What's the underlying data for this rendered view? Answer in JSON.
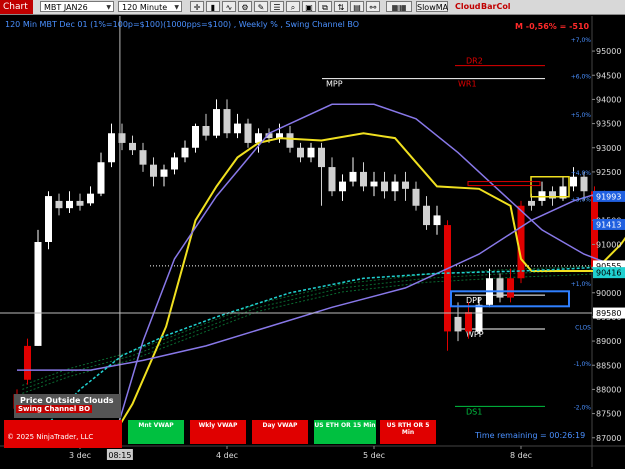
{
  "toolbar": {
    "tab": "Chart",
    "instrument": "MBT JAN26",
    "interval": "120 Minute",
    "btn_slowma": "SlowMA",
    "btn_cloud": "Cloud",
    "btn_barcol": "BarCol"
  },
  "chart": {
    "title": "120 Min MBT Dec 01 (1%=100p=$100)(1000pps=$100) , Weekly % , Swing Channel BO",
    "pnl": "M -0,56% = -510",
    "time_remaining": "Time remaining = 00:26:19",
    "copyright": "© 2025 NinjaTrader, LLC",
    "position_label": "Price Outside Clouds",
    "position_sub": "Swing Channel BO",
    "crosshair_x_label": "08:15",
    "colors": {
      "up": "#ffffff",
      "down": "#d0d0d0",
      "red": "#e00000",
      "yellow": "#f0e020",
      "purple": "#8878e8",
      "cyan": "#20d0d0",
      "axis_blue": "#4a90ff"
    }
  },
  "indicator_boxes": [
    {
      "name": "swing-channel",
      "label": "Swing Channel BO",
      "color": "#e00000"
    },
    {
      "name": "mnt-vwap",
      "label": "Mnt VWAP",
      "color": "#00c040"
    },
    {
      "name": "wkly-vwap",
      "label": "Wkly VWAP",
      "color": "#e00000"
    },
    {
      "name": "day-vwap",
      "label": "Day VWAP",
      "color": "#e00000"
    },
    {
      "name": "us-eth",
      "label": "US ETH OR 15 Min",
      "color": "#00c040"
    },
    {
      "name": "us-rth",
      "label": "US RTH OR 5 Min",
      "color": "#e00000"
    }
  ],
  "price_axis": {
    "ticks": [
      "95000",
      "94500",
      "94000",
      "93500",
      "93000",
      "92500",
      "92000",
      "91500",
      "91000",
      "90500",
      "90000",
      "89500",
      "89000",
      "88500",
      "88000",
      "87500",
      "87000"
    ],
    "pct_labels": [
      {
        "text": "+7,0%",
        "price": 95250
      },
      {
        "text": "+6,0%",
        "price": 94500
      },
      {
        "text": "+5,0%",
        "price": 93700
      },
      {
        "text": "+4,0%",
        "price": 92500
      },
      {
        "text": "+3,0%",
        "price": 91950
      },
      {
        "text": "+1,0%",
        "price": 90200
      },
      {
        "text": "CLOS",
        "price": 89300
      },
      {
        "text": "-1,0%",
        "price": 88550
      },
      {
        "text": "-2,0%",
        "price": 87650
      }
    ],
    "badges": [
      {
        "text": "91993",
        "price": 91993,
        "color": "#2060e0",
        "fg": "#ffffff"
      },
      {
        "text": "91413",
        "price": 91413,
        "color": "#2060e0",
        "fg": "#ffffff"
      },
      {
        "text": "90555",
        "price": 90555,
        "color": "#ffffff",
        "fg": "#000000"
      },
      {
        "text": "90416",
        "price": 90416,
        "color": "#20d0d0",
        "fg": "#000000"
      },
      {
        "text": "89580",
        "price": 89580,
        "color": "#ffffff",
        "fg": "#000000"
      }
    ]
  },
  "time_axis": {
    "labels": [
      {
        "text": "3 dec",
        "bar": 6
      },
      {
        "text": "4 dec",
        "bar": 20
      },
      {
        "text": "5 dec",
        "bar": 34
      },
      {
        "text": "8 dec",
        "bar": 48
      }
    ]
  },
  "levels": [
    {
      "text": "DR2",
      "price": 94700,
      "color": "#e00000"
    },
    {
      "text": "MPP",
      "price": 94430,
      "color": "#ffffff"
    },
    {
      "text": "WR1",
      "price": 94430,
      "color": "#e00000"
    },
    {
      "text": "DPP",
      "price": 89950,
      "color": "#ffffff"
    },
    {
      "text": "WPP",
      "price": 89250,
      "color": "#ffffff"
    },
    {
      "text": "DS1",
      "price": 87650,
      "color": "#00c040"
    }
  ],
  "chart_data": {
    "type": "candlestick",
    "price_range": [
      86800,
      95500
    ],
    "candles": [
      {
        "o": 87600,
        "c": 87900,
        "h": 88000,
        "l": 87500,
        "color": "red"
      },
      {
        "o": 88200,
        "c": 88900,
        "h": 89050,
        "l": 88100,
        "color": "red"
      },
      {
        "o": 88900,
        "c": 91050,
        "h": 91300,
        "l": 88900,
        "color": "up"
      },
      {
        "o": 91050,
        "c": 92000,
        "h": 92100,
        "l": 90900,
        "color": "up"
      },
      {
        "o": 91900,
        "c": 91750,
        "h": 92050,
        "l": 91600,
        "color": "dn"
      },
      {
        "o": 91750,
        "c": 91900,
        "h": 92100,
        "l": 91650,
        "color": "up"
      },
      {
        "o": 91900,
        "c": 91800,
        "h": 92050,
        "l": 91700,
        "color": "dn"
      },
      {
        "o": 91850,
        "c": 92050,
        "h": 92200,
        "l": 91800,
        "color": "up"
      },
      {
        "o": 92050,
        "c": 92700,
        "h": 92900,
        "l": 92000,
        "color": "up"
      },
      {
        "o": 92700,
        "c": 93300,
        "h": 93500,
        "l": 92600,
        "color": "up"
      },
      {
        "o": 93300,
        "c": 93100,
        "h": 93500,
        "l": 92950,
        "color": "dn"
      },
      {
        "o": 93100,
        "c": 92950,
        "h": 93250,
        "l": 92850,
        "color": "dn"
      },
      {
        "o": 92950,
        "c": 92650,
        "h": 93100,
        "l": 92500,
        "color": "dn"
      },
      {
        "o": 92650,
        "c": 92400,
        "h": 92800,
        "l": 92200,
        "color": "dn"
      },
      {
        "o": 92400,
        "c": 92550,
        "h": 92650,
        "l": 92200,
        "color": "up"
      },
      {
        "o": 92550,
        "c": 92800,
        "h": 92900,
        "l": 92450,
        "color": "up"
      },
      {
        "o": 92800,
        "c": 93000,
        "h": 93150,
        "l": 92700,
        "color": "up"
      },
      {
        "o": 93000,
        "c": 93450,
        "h": 93500,
        "l": 92900,
        "color": "up"
      },
      {
        "o": 93450,
        "c": 93250,
        "h": 93700,
        "l": 93150,
        "color": "dn"
      },
      {
        "o": 93250,
        "c": 93800,
        "h": 94000,
        "l": 93200,
        "color": "up"
      },
      {
        "o": 93800,
        "c": 93300,
        "h": 94000,
        "l": 93200,
        "color": "dn"
      },
      {
        "o": 93300,
        "c": 93500,
        "h": 93700,
        "l": 93200,
        "color": "up"
      },
      {
        "o": 93500,
        "c": 93100,
        "h": 93600,
        "l": 93000,
        "color": "dn"
      },
      {
        "o": 93100,
        "c": 93300,
        "h": 93400,
        "l": 92900,
        "color": "up"
      },
      {
        "o": 93300,
        "c": 93200,
        "h": 93400,
        "l": 93100,
        "color": "dn"
      },
      {
        "o": 93200,
        "c": 93300,
        "h": 93500,
        "l": 93100,
        "color": "up"
      },
      {
        "o": 93300,
        "c": 93000,
        "h": 93450,
        "l": 92900,
        "color": "dn"
      },
      {
        "o": 93000,
        "c": 92800,
        "h": 93100,
        "l": 92700,
        "color": "dn"
      },
      {
        "o": 92800,
        "c": 93000,
        "h": 93100,
        "l": 92700,
        "color": "up"
      },
      {
        "o": 93000,
        "c": 92600,
        "h": 93100,
        "l": 91800,
        "color": "dn"
      },
      {
        "o": 92600,
        "c": 92100,
        "h": 92800,
        "l": 92000,
        "color": "dn"
      },
      {
        "o": 92100,
        "c": 92300,
        "h": 92450,
        "l": 91900,
        "color": "up"
      },
      {
        "o": 92300,
        "c": 92500,
        "h": 92800,
        "l": 92200,
        "color": "up"
      },
      {
        "o": 92500,
        "c": 92200,
        "h": 92700,
        "l": 92100,
        "color": "dn"
      },
      {
        "o": 92200,
        "c": 92300,
        "h": 92500,
        "l": 92000,
        "color": "up"
      },
      {
        "o": 92300,
        "c": 92100,
        "h": 92500,
        "l": 91950,
        "color": "dn"
      },
      {
        "o": 92100,
        "c": 92300,
        "h": 92450,
        "l": 91900,
        "color": "up"
      },
      {
        "o": 92300,
        "c": 92150,
        "h": 92500,
        "l": 91900,
        "color": "dn"
      },
      {
        "o": 92150,
        "c": 91800,
        "h": 92300,
        "l": 91700,
        "color": "dn"
      },
      {
        "o": 91800,
        "c": 91400,
        "h": 92000,
        "l": 91300,
        "color": "dn"
      },
      {
        "o": 91400,
        "c": 91600,
        "h": 91800,
        "l": 91200,
        "color": "up"
      },
      {
        "o": 91400,
        "c": 89200,
        "h": 91500,
        "l": 88800,
        "color": "red"
      },
      {
        "o": 89200,
        "c": 89500,
        "h": 89800,
        "l": 89000,
        "color": "dn"
      },
      {
        "o": 89600,
        "c": 89200,
        "h": 89800,
        "l": 89050,
        "color": "red"
      },
      {
        "o": 89200,
        "c": 89750,
        "h": 89900,
        "l": 89150,
        "color": "up"
      },
      {
        "o": 89750,
        "c": 90300,
        "h": 90500,
        "l": 89700,
        "color": "up"
      },
      {
        "o": 90300,
        "c": 89900,
        "h": 90400,
        "l": 89800,
        "color": "dn"
      },
      {
        "o": 89900,
        "c": 90300,
        "h": 90500,
        "l": 89800,
        "color": "red"
      },
      {
        "o": 90300,
        "c": 91800,
        "h": 91900,
        "l": 90200,
        "color": "red"
      },
      {
        "o": 91800,
        "c": 91900,
        "h": 92050,
        "l": 91700,
        "color": "dn"
      },
      {
        "o": 91900,
        "c": 92100,
        "h": 92300,
        "l": 91800,
        "color": "up"
      },
      {
        "o": 92100,
        "c": 91950,
        "h": 92200,
        "l": 91800,
        "color": "dn"
      },
      {
        "o": 91950,
        "c": 92200,
        "h": 92400,
        "l": 91900,
        "color": "up"
      },
      {
        "o": 92200,
        "c": 92400,
        "h": 92600,
        "l": 92100,
        "color": "up"
      },
      {
        "o": 92400,
        "c": 92100,
        "h": 92500,
        "l": 91900,
        "color": "dn"
      },
      {
        "o": 92100,
        "c": 90500,
        "h": 92200,
        "l": 90400,
        "color": "red"
      }
    ],
    "series": [
      {
        "name": "yellow",
        "color": "#f0e020",
        "points": [
          [
            8.5,
            86800
          ],
          [
            11,
            87700
          ],
          [
            13,
            88700
          ],
          [
            14.2,
            89300
          ],
          [
            17,
            91500
          ],
          [
            19,
            92200
          ],
          [
            21,
            92800
          ],
          [
            23,
            93100
          ],
          [
            25,
            93200
          ],
          [
            29,
            93150
          ],
          [
            33,
            93300
          ],
          [
            36,
            93200
          ],
          [
            38,
            92700
          ],
          [
            40,
            92200
          ],
          [
            44,
            92150
          ],
          [
            47,
            91800
          ],
          [
            48,
            90700
          ],
          [
            49,
            90450
          ],
          [
            52,
            90450
          ],
          [
            55,
            90450
          ],
          [
            57.5,
            91000
          ],
          [
            59.5,
            91600
          ]
        ]
      },
      {
        "name": "purple",
        "color": "#8878e8",
        "points": [
          [
            0,
            88400
          ],
          [
            7,
            88400
          ],
          [
            12,
            88600
          ],
          [
            18,
            88900
          ],
          [
            24,
            89300
          ],
          [
            30,
            89700
          ],
          [
            37,
            90100
          ],
          [
            44,
            90800
          ],
          [
            49,
            91500
          ],
          [
            53,
            91900
          ],
          [
            56,
            92100
          ]
        ]
      },
      {
        "name": "purple-arc",
        "color": "#8878e8",
        "points": [
          [
            9,
            86800
          ],
          [
            12,
            89000
          ],
          [
            15,
            90700
          ],
          [
            19,
            92000
          ],
          [
            24,
            93300
          ],
          [
            30,
            93900
          ],
          [
            34,
            93900
          ],
          [
            38,
            93600
          ],
          [
            42,
            92900
          ],
          [
            46,
            92100
          ],
          [
            50,
            91300
          ],
          [
            54,
            90800
          ],
          [
            57,
            90550
          ]
        ]
      },
      {
        "name": "cyan",
        "color": "#20d0d0",
        "points": [
          [
            1,
            86800
          ],
          [
            3,
            87300
          ],
          [
            6,
            88000
          ],
          [
            10,
            88700
          ],
          [
            14,
            89100
          ],
          [
            19,
            89500
          ],
          [
            26,
            90000
          ],
          [
            33,
            90300
          ],
          [
            40,
            90400
          ],
          [
            48,
            90450
          ],
          [
            53,
            90500
          ],
          [
            57,
            90550
          ]
        ]
      }
    ],
    "green_channel": [
      [
        0.5,
        88000
      ],
      [
        5,
        88350
      ],
      [
        11,
        88700
      ],
      [
        17,
        89200
      ],
      [
        23,
        89700
      ],
      [
        31,
        90100
      ],
      [
        39,
        90300
      ],
      [
        47,
        90400
      ],
      [
        53,
        90450
      ],
      [
        57,
        90500
      ]
    ]
  }
}
